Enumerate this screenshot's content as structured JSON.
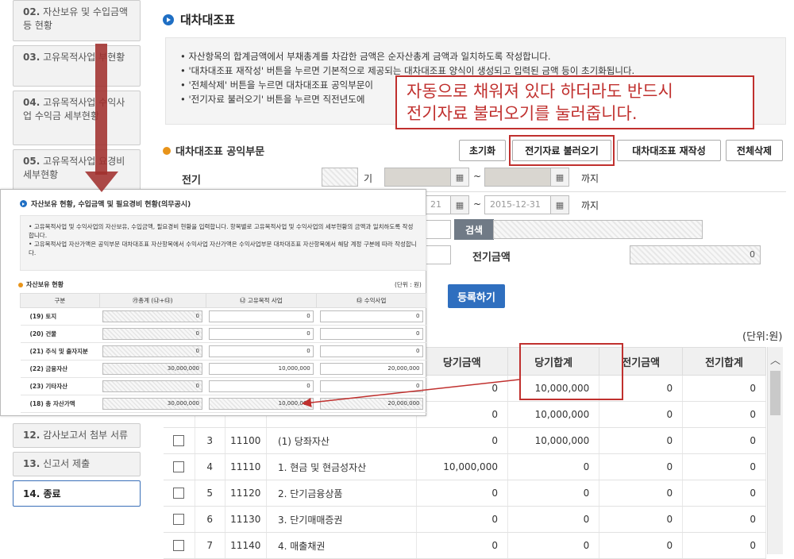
{
  "sidebar": {
    "items": [
      {
        "num": "02.",
        "label": "자산보유 및 수입금액 등 현황",
        "active": false
      },
      {
        "num": "03.",
        "label": "고유목적사업 부현황",
        "active": false
      },
      {
        "num": "04.",
        "label": "고유목적사업 수익사업 수익금 세부현황",
        "active": false
      },
      {
        "num": "05.",
        "label": "고유목적사업 요경비 세부현황",
        "active": false
      }
    ],
    "bottom_items": [
      {
        "num": "12.",
        "label": "감사보고서 첨부 서류"
      },
      {
        "num": "13.",
        "label": "신고서 제출"
      },
      {
        "num": "14.",
        "label": "종료"
      }
    ]
  },
  "page": {
    "title": "대차대조표",
    "guide": [
      "자산항목의 합계금액에서 부채총계를 차감한 금액은 순자산총계 금액과 일치하도록 작성합니다.",
      "'대차대조표 재작성' 버튼을 누르면 기본적으로 제공되는 대차대조표 양식이 생성되고 입력된 금액 등이 초기화됩니다.",
      "'전체삭제' 버튼을 누르면 대차대조표 공익부문이",
      "'전기자료 불러오기' 버튼을 누르면 직전년도에"
    ],
    "callout_line1": "자동으로 채워져 있다 하더라도 반드시",
    "callout_line2": "전기자료 불러오기를 눌러줍니다.",
    "section_title": "대차대조표 공익부문",
    "buttons": {
      "reset": "초기화",
      "load_prev": "전기자료 불러오기",
      "rewrite": "대차대조표 재작성",
      "delete_all": "전체삭제"
    },
    "form": {
      "prev_label": "전기",
      "period_suffix": "기",
      "tilde": "~",
      "until": "까지",
      "cur_date_start": "21",
      "cur_date_end": "2015-12-31",
      "search_btn": "검색",
      "prev_amount_label": "전기금액",
      "prev_amount_value": "0",
      "register_btn": "등록하기"
    },
    "unit_label": "(단위:원)",
    "table": {
      "headers": [
        "당기금액",
        "당기합계",
        "전기금액",
        "전기합계"
      ],
      "rows": [
        {
          "no": "",
          "code": "",
          "name": "",
          "cur": "0",
          "cur_sum": "10,000,000",
          "prev": "0",
          "prev_sum": "0",
          "checkbox": false
        },
        {
          "no": "",
          "code": "",
          "name": "",
          "cur": "0",
          "cur_sum": "10,000,000",
          "prev": "0",
          "prev_sum": "0",
          "checkbox": false
        },
        {
          "no": "3",
          "code": "11100",
          "name": "(1) 당좌자산",
          "cur": "0",
          "cur_sum": "10,000,000",
          "prev": "0",
          "prev_sum": "0",
          "checkbox": true
        },
        {
          "no": "4",
          "code": "11110",
          "name": "1. 현금 및 현금성자산",
          "cur": "10,000,000",
          "cur_sum": "0",
          "prev": "0",
          "prev_sum": "0",
          "checkbox": true
        },
        {
          "no": "5",
          "code": "11120",
          "name": "2. 단기금융상품",
          "cur": "0",
          "cur_sum": "0",
          "prev": "0",
          "prev_sum": "0",
          "checkbox": true
        },
        {
          "no": "6",
          "code": "11130",
          "name": "3. 단기매매증권",
          "cur": "0",
          "cur_sum": "0",
          "prev": "0",
          "prev_sum": "0",
          "checkbox": true
        },
        {
          "no": "7",
          "code": "11140",
          "name": "4. 매출채권",
          "cur": "0",
          "cur_sum": "0",
          "prev": "0",
          "prev_sum": "0",
          "checkbox": true
        }
      ]
    }
  },
  "overlay": {
    "title": "자산보유 현황, 수입금액 및 필요경비 현황(의무공시)",
    "guide": [
      "고유목적사업 및 수익사업의 자산보유, 수입금액, 필요경비 현황을 입력합니다. 항목별로 고유목적사업 및 수익사업의 세부현황의 금액과 일치하도록 작성합니다.",
      "고유목적사업 자산가액은 공익부문 대차대조표 자산항목에서 수익사업 자산가액은 수익사업부문 대차대조표 자산항목에서 해당 계정 구분에 따라 작성합니다."
    ],
    "sub_title": "자산보유 현황",
    "unit": "(단위 : 원)",
    "headers": [
      "구분",
      "㉮총계 (㉯+㉰)",
      "㉯ 고유목적 사업",
      "㉰ 수익사업"
    ],
    "rows": [
      {
        "label": "(19) 토지",
        "total": "0",
        "own": "0",
        "profit": "0"
      },
      {
        "label": "(20) 건물",
        "total": "0",
        "own": "0",
        "profit": "0"
      },
      {
        "label": "(21) 주식 및 출자지분",
        "total": "0",
        "own": "0",
        "profit": "0"
      },
      {
        "label": "(22) 금융자산",
        "total": "30,000,000",
        "own": "10,000,000",
        "profit": "20,000,000"
      },
      {
        "label": "(23) 기타자산",
        "total": "0",
        "own": "0",
        "profit": "0"
      },
      {
        "label": "(18) 총 자산가액",
        "total": "30,000,000",
        "own": "10,000,000",
        "profit": "20,000,000"
      }
    ]
  },
  "colors": {
    "accent_blue": "#2f6fbf",
    "annotation_red": "#c0302e"
  }
}
